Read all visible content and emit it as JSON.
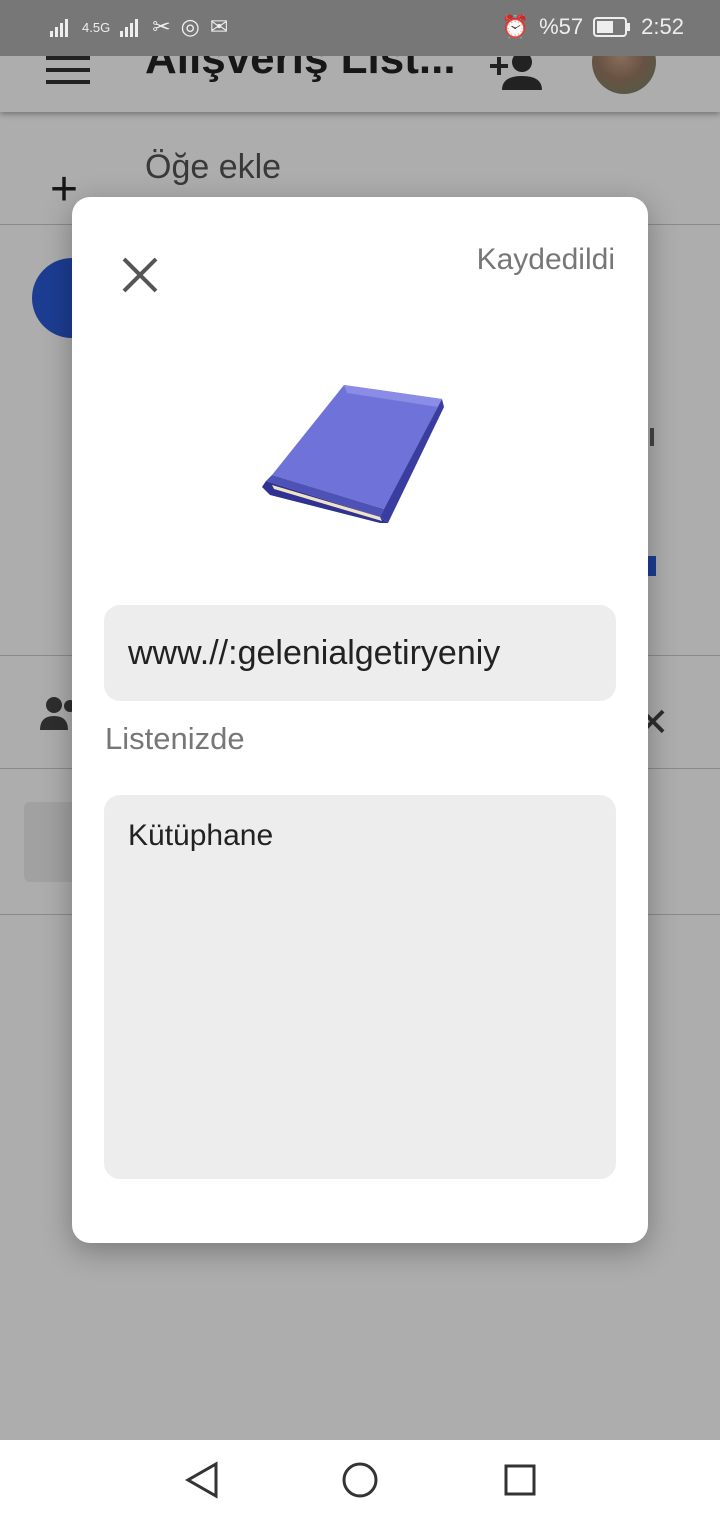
{
  "statusbar": {
    "network": "4.5G",
    "battery_percent": "%57",
    "time": "2:52"
  },
  "appbar": {
    "title": "Alışveriş List..."
  },
  "add_row": {
    "label": "Öğe ekle"
  },
  "dialog": {
    "status": "Kaydedildi",
    "url_value": "www.//:gelenialgetiryeniy",
    "list_label": "Listenizde",
    "note_value": "Kütüphane"
  },
  "colors": {
    "accent": "#2a5bd7",
    "field_bg": "#ededed",
    "muted_text": "#777777"
  },
  "icons": [
    "menu-icon",
    "add-person-icon",
    "plus-icon",
    "close-icon",
    "book-icon",
    "back-icon",
    "home-icon",
    "recents-icon"
  ]
}
